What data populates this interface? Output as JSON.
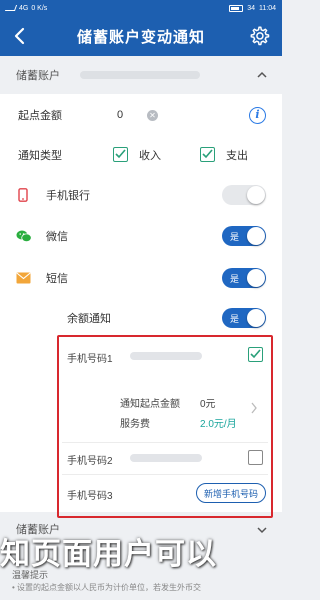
{
  "status_bar": {
    "signal_left": "4G",
    "speed": "0 K/s",
    "battery": "34",
    "time": "11:04"
  },
  "header": {
    "title": "储蓄账户变动通知"
  },
  "account": {
    "section_label": "储蓄账户"
  },
  "amount": {
    "label": "起点金额",
    "value": "0"
  },
  "notify_type": {
    "label": "通知类型",
    "option_in": "收入",
    "option_out": "支出",
    "in_checked": true,
    "out_checked": true
  },
  "channels": [
    {
      "label": "手机银行",
      "state": "否",
      "on": false,
      "icon": "mobile-phone-icon"
    },
    {
      "label": "微信",
      "state": "是",
      "on": true,
      "icon": "wechat-icon"
    },
    {
      "label": "短信",
      "state": "是",
      "on": true,
      "icon": "envelope-icon"
    }
  ],
  "balance_notify": {
    "label": "余额通知",
    "state": "是"
  },
  "phones": {
    "phone1_label": "手机号码1",
    "phone1_checked": true,
    "threshold_label": "通知起点金额",
    "threshold_value": "0元",
    "fee_label": "服务费",
    "fee_value": "2.0元/月",
    "phone2_label": "手机号码2",
    "phone2_checked": false,
    "phone3_label": "手机号码3",
    "add_phone_label": "新增手机号码"
  },
  "bottom_section": {
    "label": "储蓄账户"
  },
  "caption": "知页面用户可以",
  "note_label": "温馨提示",
  "footnote": "• 设置的起点金额以人民币为计价单位，若发生外币交"
}
